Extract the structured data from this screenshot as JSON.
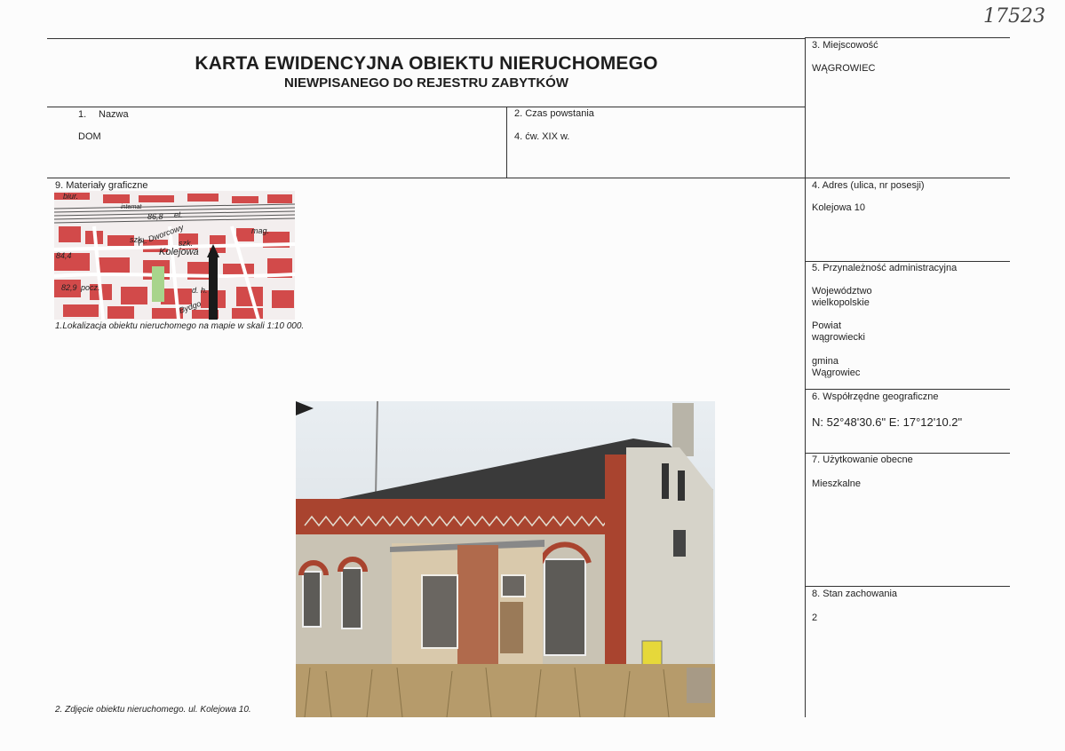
{
  "handwritten_number": "17523",
  "header": {
    "title": "KARTA EWIDENCYJNA OBIEKTU NIERUCHOMEGO",
    "subtitle": "NIEWPISANEGO DO REJESTRU ZABYTKÓW"
  },
  "fields": {
    "miejscowosc": {
      "label": "3. Miejscowość",
      "value": "WĄGROWIEC"
    },
    "nazwa": {
      "label_num": "1.",
      "label": "Nazwa",
      "value": "DOM"
    },
    "czas": {
      "label": "2. Czas powstania",
      "value": "4. ćw. XIX w."
    },
    "adres": {
      "label": "4. Adres (ulica, nr posesji)",
      "value": "Kolejowa 10"
    },
    "przynaleznosc": {
      "label": "5. Przynależność administracyjna",
      "woj_label": "Województwo",
      "woj_value": "wielkopolskie",
      "powiat_label": "Powiat",
      "powiat_value": "wągrowiecki",
      "gmina_label": "gmina",
      "gmina_value": "Wągrowiec"
    },
    "wspolrzedne": {
      "label": "6. Współrzędne geograficzne",
      "value": "N: 52°48'30.6\"  E: 17°12'10.2\""
    },
    "uzytkowanie": {
      "label": "7. Użytkowanie obecne",
      "value": "Mieszkalne"
    },
    "stan": {
      "label": "8. Stan zachowania",
      "value": "2"
    },
    "materialy": {
      "label": "9. Materiały graficzne"
    }
  },
  "map": {
    "caption": "1.Lokalizacja obiektu nieruchomego na mapie w skali 1:10 000.",
    "labels": [
      "biur.",
      "internat",
      "86,8",
      "el.",
      "Pl. Dworcowy",
      "szk.",
      "szk.",
      "mag.",
      "84,4",
      "Kolejowa",
      "82,9",
      "pocz.",
      "d. h.",
      "Bydgo"
    ]
  },
  "photo": {
    "caption": "2. Zdjęcie obiektu nieruchomego. ul. Kolejowa 10."
  }
}
